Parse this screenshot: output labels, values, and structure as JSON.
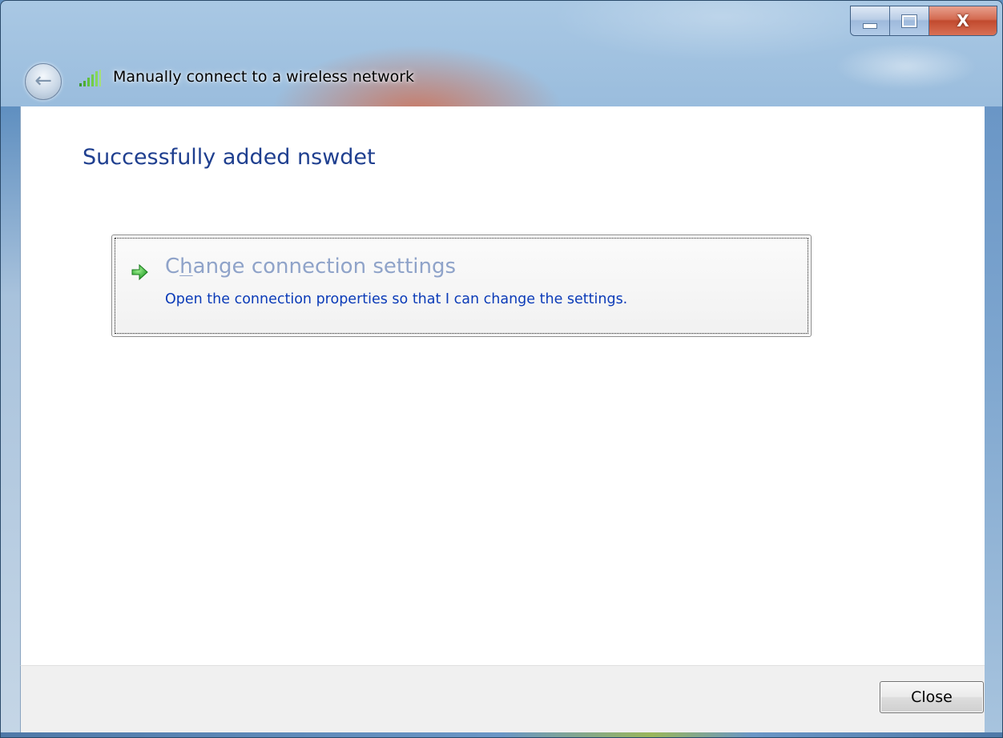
{
  "window": {
    "title": "Manually connect to a wireless network",
    "caption": {
      "minimize_icon": "minimize-icon",
      "maximize_icon": "maximize-icon",
      "close_glyph": "X"
    },
    "back_icon": "back-arrow-icon",
    "title_icon": "wireless-signal-icon"
  },
  "content": {
    "heading": "Successfully added nswdet",
    "command_link": {
      "icon": "green-arrow-icon",
      "title_prefix": "C",
      "title_accel": "h",
      "title_suffix": "ange connection settings",
      "description": "Open the connection properties so that I can change the settings."
    }
  },
  "footer": {
    "close_label": "Close"
  },
  "colors": {
    "heading": "#1f3f8f",
    "link_title": "#8fa3c9",
    "link_desc": "#0b3bb8",
    "arrow": "#2fb52f"
  }
}
